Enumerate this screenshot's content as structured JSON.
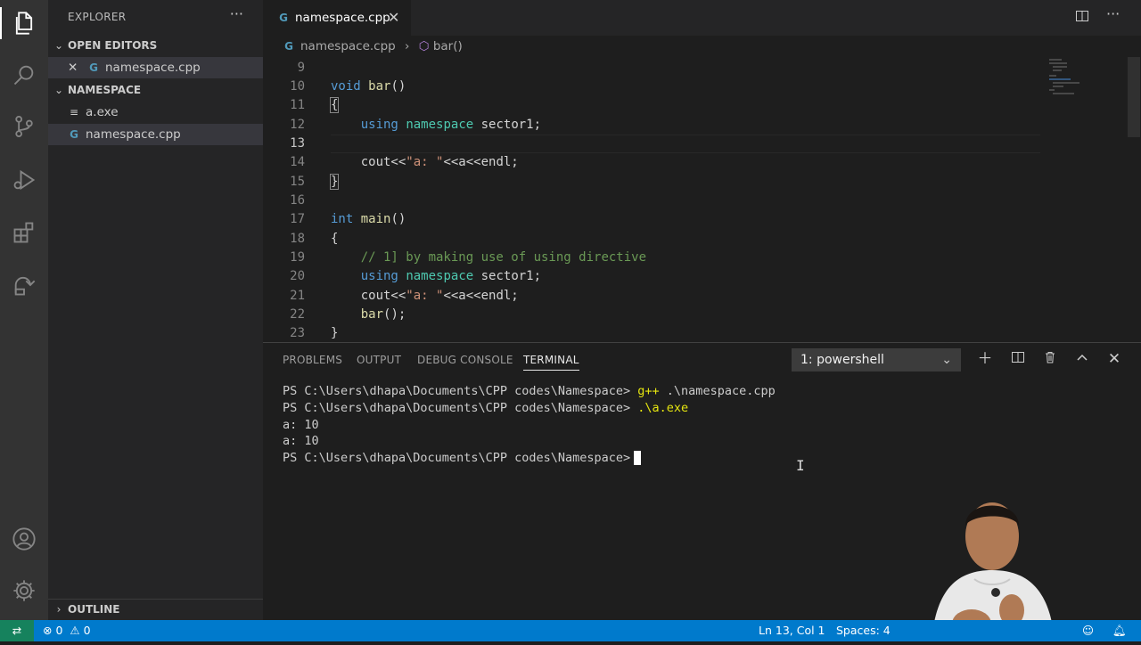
{
  "activity_bar": {
    "items": [
      "explorer-icon",
      "search-icon",
      "source-control-icon",
      "run-debug-icon",
      "extensions-icon",
      "remote-explorer-icon"
    ],
    "bottom": [
      "account-icon",
      "settings-gear-icon"
    ]
  },
  "sidebar": {
    "title": "EXPLORER",
    "more": "···",
    "open_editors": {
      "label": "OPEN EDITORS",
      "items": [
        {
          "close": "✕",
          "icon": "G",
          "name": "namespace.cpp"
        }
      ]
    },
    "folder": {
      "label": "NAMESPACE",
      "items": [
        {
          "icon": "≡",
          "name": "a.exe"
        },
        {
          "icon": "G",
          "name": "namespace.cpp"
        }
      ]
    },
    "outline": "OUTLINE"
  },
  "tabs": [
    {
      "icon": "G",
      "label": "namespace.cpp",
      "close": "✕"
    }
  ],
  "breadcrumb": {
    "file": "namespace.cpp",
    "symbol": "bar()"
  },
  "editor": {
    "lines": [
      {
        "n": "9"
      },
      {
        "n": "10"
      },
      {
        "n": "11"
      },
      {
        "n": "12"
      },
      {
        "n": "13"
      },
      {
        "n": "14"
      },
      {
        "n": "15"
      },
      {
        "n": "16"
      },
      {
        "n": "17"
      },
      {
        "n": "18"
      },
      {
        "n": "19"
      },
      {
        "n": "20"
      },
      {
        "n": "21"
      },
      {
        "n": "22"
      },
      {
        "n": "23"
      }
    ],
    "code": {
      "l10_kw": "void",
      "l10_fn": "bar",
      "l10_rest": "()",
      "l11": "{",
      "l12_kw": "using",
      "l12_ns": "namespace",
      "l12_rest": "sector1;",
      "l14_a": "cout<<",
      "l14_str": "\"a: \"",
      "l14_b": "<<a<<endl;",
      "l15": "}",
      "l17_kw": "int",
      "l17_fn": "main",
      "l17_rest": "()",
      "l18": "{",
      "l19_cm": "// 1] by making use of using directive",
      "l20_kw": "using",
      "l20_ns": "namespace",
      "l20_rest": "sector1;",
      "l21_a": "cout<<",
      "l21_str": "\"a: \"",
      "l21_b": "<<a<<endl;",
      "l22_fn": "bar",
      "l22_rest": "();",
      "l23": "}"
    }
  },
  "panel": {
    "tabs": [
      "PROBLEMS",
      "OUTPUT",
      "DEBUG CONSOLE",
      "TERMINAL"
    ],
    "active_tab": "TERMINAL",
    "terminal_select": "1: powershell",
    "terminal": {
      "l1_prompt": "PS C:\\Users\\dhapa\\Documents\\CPP codes\\Namespace>",
      "l1_cmd": "g++",
      "l1_arg": " .\\namespace.cpp",
      "l2_prompt": "PS C:\\Users\\dhapa\\Documents\\CPP codes\\Namespace>",
      "l2_cmd": ".\\a.exe",
      "l3": "a: 10",
      "l4": "a: 10",
      "l5_prompt": "PS C:\\Users\\dhapa\\Documents\\CPP codes\\Namespace>"
    }
  },
  "status_bar": {
    "errors": "0",
    "warnings": "0",
    "position": "Ln 13, Col 1",
    "spaces": "Spaces: 4"
  },
  "colors": {
    "accent": "#007acc",
    "remote": "#16825d"
  }
}
